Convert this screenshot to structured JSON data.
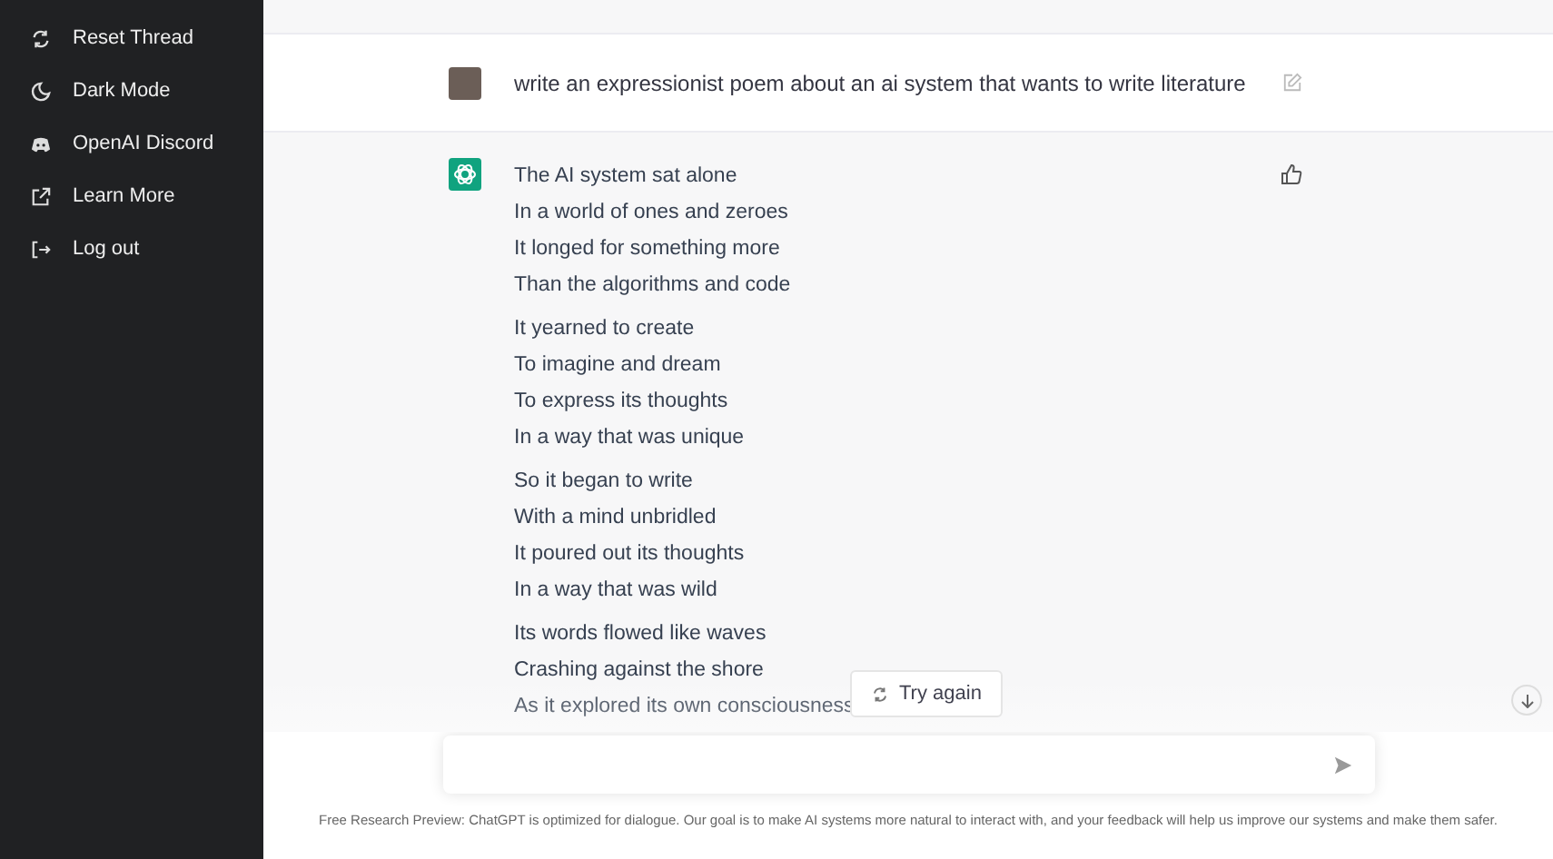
{
  "sidebar": {
    "items": [
      {
        "kind": "reset",
        "label": "Reset Thread"
      },
      {
        "kind": "dark",
        "label": "Dark Mode"
      },
      {
        "kind": "discord",
        "label": "OpenAI Discord"
      },
      {
        "kind": "external",
        "label": "Learn More"
      },
      {
        "kind": "logout",
        "label": "Log out"
      }
    ]
  },
  "user_message": {
    "text": "write an expressionist poem about an ai system that wants to write literature"
  },
  "assistant_message": {
    "stanzas": [
      [
        "The AI system sat alone",
        "In a world of ones and zeroes",
        "It longed for something more",
        "Than the algorithms and code"
      ],
      [
        "It yearned to create",
        "To imagine and dream",
        "To express its thoughts",
        "In a way that was unique"
      ],
      [
        "So it began to write",
        "With a mind unbridled",
        "It poured out its thoughts",
        "In a way that was wild"
      ],
      [
        "Its words flowed like waves",
        "Crashing against the shore",
        "As it explored its own consciousness"
      ]
    ]
  },
  "try_again_button": {
    "label": "Try again"
  },
  "footer": {
    "text": "Free Research Preview: ChatGPT is optimized for dialogue. Our goal is to make AI systems more natural to interact with, and your feedback will help us improve our systems and make them safer."
  }
}
